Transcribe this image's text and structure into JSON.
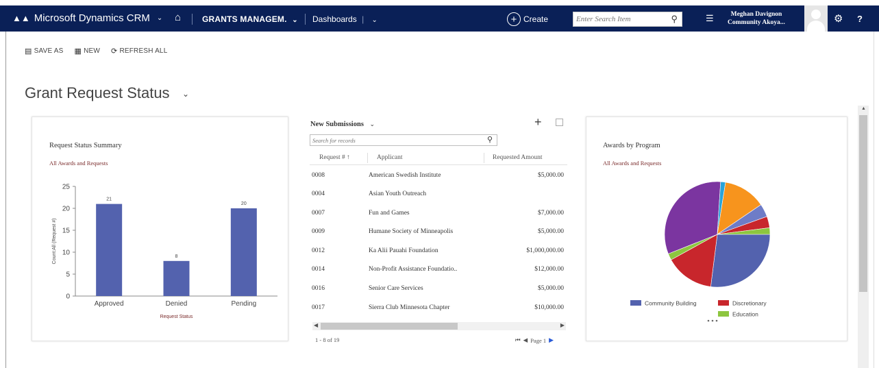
{
  "topbar": {
    "brand": "Microsoft Dynamics CRM",
    "module": "GRANTS MANAGEM.",
    "dashboards": "Dashboards",
    "create": "Create",
    "search_placeholder": "Enter Search Item",
    "user_name": "Meghan Davignon",
    "user_org": "Community Akoya..."
  },
  "commands": {
    "save_as": "SAVE AS",
    "new": "NEW",
    "refresh_all": "REFRESH ALL"
  },
  "page": {
    "title": "Grant Request Status"
  },
  "status_chart": {
    "title": "Request Status Summary",
    "subtitle": "All Awards and Requests"
  },
  "grid": {
    "view_name": "New Submissions",
    "search_placeholder": "Search for records",
    "columns": [
      "Request # ↑",
      "Applicant",
      "Requested Amount"
    ],
    "rows": [
      {
        "id": "0008",
        "applicant": "American Swedish Institute",
        "amount": "$5,000.00"
      },
      {
        "id": "0004",
        "applicant": "Asian Youth Outreach",
        "amount": ""
      },
      {
        "id": "0007",
        "applicant": "Fun and Games",
        "amount": "$7,000.00"
      },
      {
        "id": "0009",
        "applicant": "Humane Society of Minneapolis",
        "amount": "$5,000.00"
      },
      {
        "id": "0012",
        "applicant": "Ka Alii Pauahi Foundation",
        "amount": "$1,000,000.00"
      },
      {
        "id": "0014",
        "applicant": "Non-Profit Assistance Foundatio..",
        "amount": "$12,000.00"
      },
      {
        "id": "0016",
        "applicant": "Senior Care Services",
        "amount": "$5,000.00"
      },
      {
        "id": "0017",
        "applicant": "Sierra Club Minnesota Chapter",
        "amount": "$10,000.00"
      }
    ],
    "footer": "1 - 8 of 19",
    "page_label": "Page 1"
  },
  "awards_chart": {
    "title": "Awards by Program",
    "subtitle": "All Awards and Requests"
  },
  "chart_data": [
    {
      "type": "bar",
      "title": "Request Status Summary",
      "subtitle": "All Awards and Requests",
      "categories": [
        "Approved",
        "Denied",
        "Pending"
      ],
      "values": [
        21,
        8,
        20
      ],
      "data_labels": [
        "21",
        "8",
        "20"
      ],
      "xlabel": "Request Status",
      "ylabel": "Count:All (Request #)",
      "ylim": [
        0,
        25
      ],
      "yticks": [
        0,
        5,
        10,
        15,
        20,
        25
      ],
      "bar_color": "#5362ae",
      "grid": false
    },
    {
      "type": "pie",
      "title": "Awards by Program",
      "subtitle": "All Awards and Requests",
      "legend_position": "bottom",
      "legend": [
        {
          "name": "Community Building",
          "color": "#5362ae"
        },
        {
          "name": "Discretionary",
          "color": "#c8262c"
        },
        {
          "name": "Education",
          "color": "#8dc63f"
        }
      ],
      "slices": [
        {
          "value": 27,
          "color": "#5362ae"
        },
        {
          "value": 15,
          "color": "#c8262c"
        },
        {
          "value": 2,
          "color": "#8dc63f"
        },
        {
          "value": 32,
          "color": "#7b35a0"
        },
        {
          "value": 1.5,
          "color": "#2aa3d8"
        },
        {
          "value": 13,
          "color": "#f7941d"
        },
        {
          "value": 4,
          "color": "#6e7cc7"
        },
        {
          "value": 3.5,
          "color": "#c8262c"
        },
        {
          "value": 2,
          "color": "#8dc63f"
        }
      ]
    }
  ]
}
